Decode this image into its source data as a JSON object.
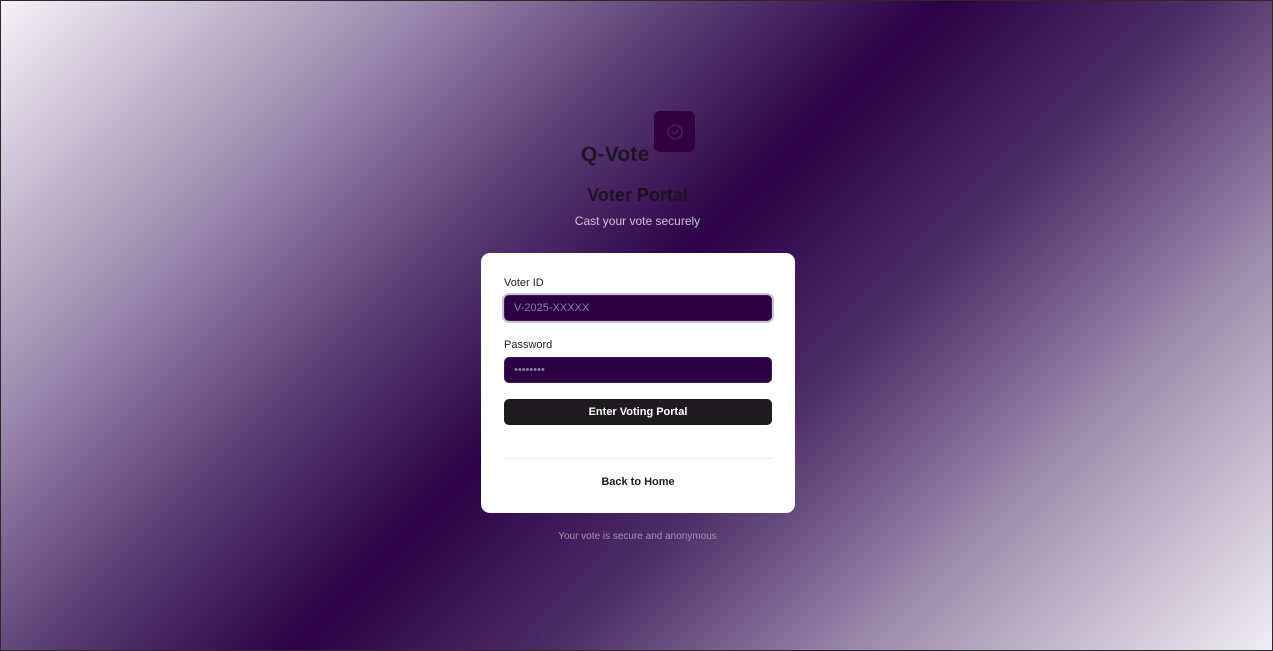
{
  "brand": {
    "name": "Q-Vote",
    "icon": "ballot-icon",
    "mark_color": "#32003f"
  },
  "header": {
    "title": "Voter Portal",
    "subtitle": "Cast your vote securely"
  },
  "form": {
    "voter_id": {
      "label": "Voter ID",
      "placeholder": "V-2025-XXXXX",
      "value": ""
    },
    "password": {
      "label": "Password",
      "placeholder": "••••••••",
      "value": ""
    },
    "submit_label": "Enter Voting Portal",
    "back_label": "Back to Home"
  },
  "footer": {
    "note": "Your vote is secure and anonymous"
  },
  "colors": {
    "gradient_dark": "#2c0147",
    "input_bg": "#2c0045",
    "button_bg": "#1d1b1e"
  }
}
